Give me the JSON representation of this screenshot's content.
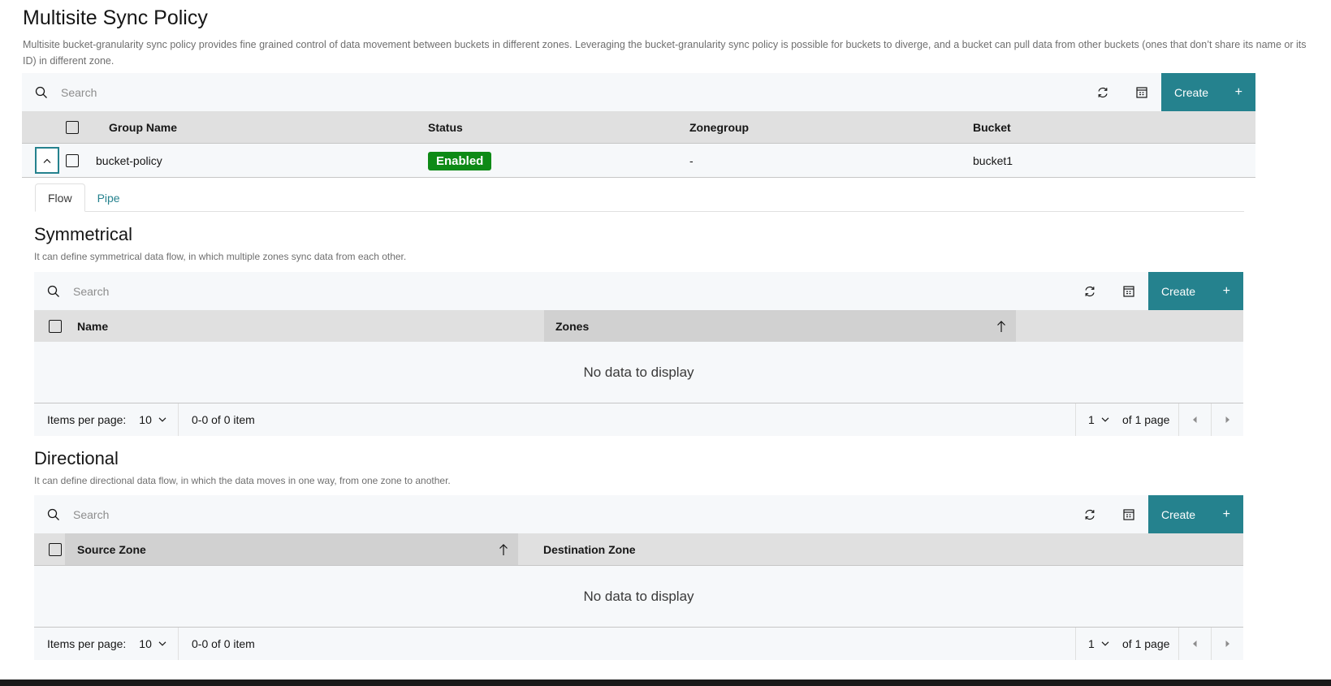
{
  "page": {
    "title": "Multisite Sync Policy",
    "description": "Multisite bucket-granularity sync policy provides fine grained control of data movement between buckets in different zones. Leveraging the bucket-granularity sync policy is possible for buckets to diverge, and a bucket can pull data from other buckets (ones that don’t share its name or its ID) in different zone."
  },
  "main_table": {
    "search_placeholder": "Search",
    "create_label": "Create",
    "create_icon": "+",
    "columns": [
      "Group Name",
      "Status",
      "Zonegroup",
      "Bucket"
    ],
    "rows": [
      {
        "group_name": "bucket-policy",
        "status": "Enabled",
        "zonegroup": "-",
        "bucket": "bucket1",
        "expanded": true
      }
    ],
    "status_color": "#0e8a16"
  },
  "detail_tabs": [
    {
      "label": "Flow",
      "active": true
    },
    {
      "label": "Pipe",
      "active": false
    }
  ],
  "symmetrical": {
    "title": "Symmetrical",
    "description": "It can define symmetrical data flow, in which multiple zones sync data from each other.",
    "search_placeholder": "Search",
    "create_label": "Create",
    "create_icon": "+",
    "columns": [
      "Name",
      "Zones"
    ],
    "sorted_column": "Zones",
    "sort_direction": "ascending",
    "empty_text": "No data to display",
    "pagination": {
      "items_per_page_label": "Items per page:",
      "items_per_page": "10",
      "range_text": "0-0 of 0 item",
      "current_page": "1",
      "of_pages_text": "of 1 page"
    }
  },
  "directional": {
    "title": "Directional",
    "description": "It can define directional data flow, in which the data moves in one way, from one zone to another.",
    "search_placeholder": "Search",
    "create_label": "Create",
    "create_icon": "+",
    "columns": [
      "Source Zone",
      "Destination Zone"
    ],
    "sorted_column": "Source Zone",
    "sort_direction": "ascending",
    "empty_text": "No data to display",
    "pagination": {
      "items_per_page_label": "Items per page:",
      "items_per_page": "10",
      "range_text": "0-0 of 0 item",
      "current_page": "1",
      "of_pages_text": "of 1 page"
    }
  },
  "theme": {
    "accent": "#25828e",
    "success": "#0e8a16"
  }
}
